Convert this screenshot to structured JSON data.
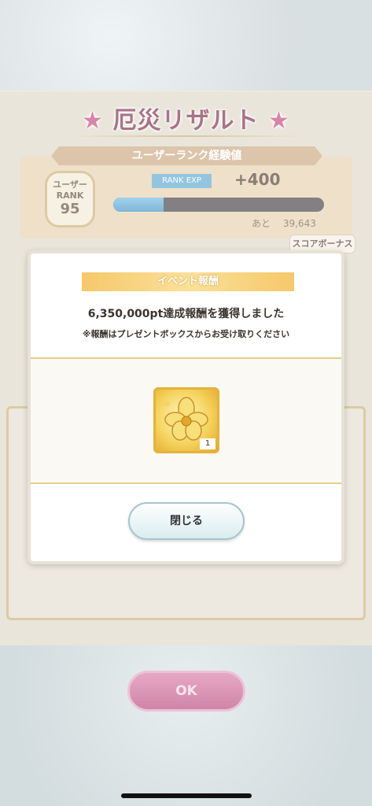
{
  "result": {
    "title_star_left": "★",
    "title_text": "厄災リザルト",
    "title_star_right": "★",
    "rank_header": "ユーザーランク経験値",
    "rank_badge_line1": "ユーザー",
    "rank_badge_line2": "RANK",
    "rank_value": "95",
    "exp_tag": "RANK EXP",
    "exp_gain": "+400",
    "exp_progress": 0.24,
    "remain_label": "あと",
    "remain_value": "39,643",
    "score_bonus": "スコアボーナス",
    "ok_label": "OK"
  },
  "dialog": {
    "header": "イベント報酬",
    "main_text": "6,350,000pt達成報酬を獲得しました",
    "note": "※報酬はプレゼントボックスからお受け取りください",
    "item_icon": "golden-flower-icon",
    "item_quantity": "1",
    "close_label": "閉じる"
  },
  "colors": {
    "accent_gold": "#e5b23c",
    "title_color": "#7a2a4a",
    "exp_bar": "#3f8fc2",
    "ok_button": "#b8447a"
  }
}
